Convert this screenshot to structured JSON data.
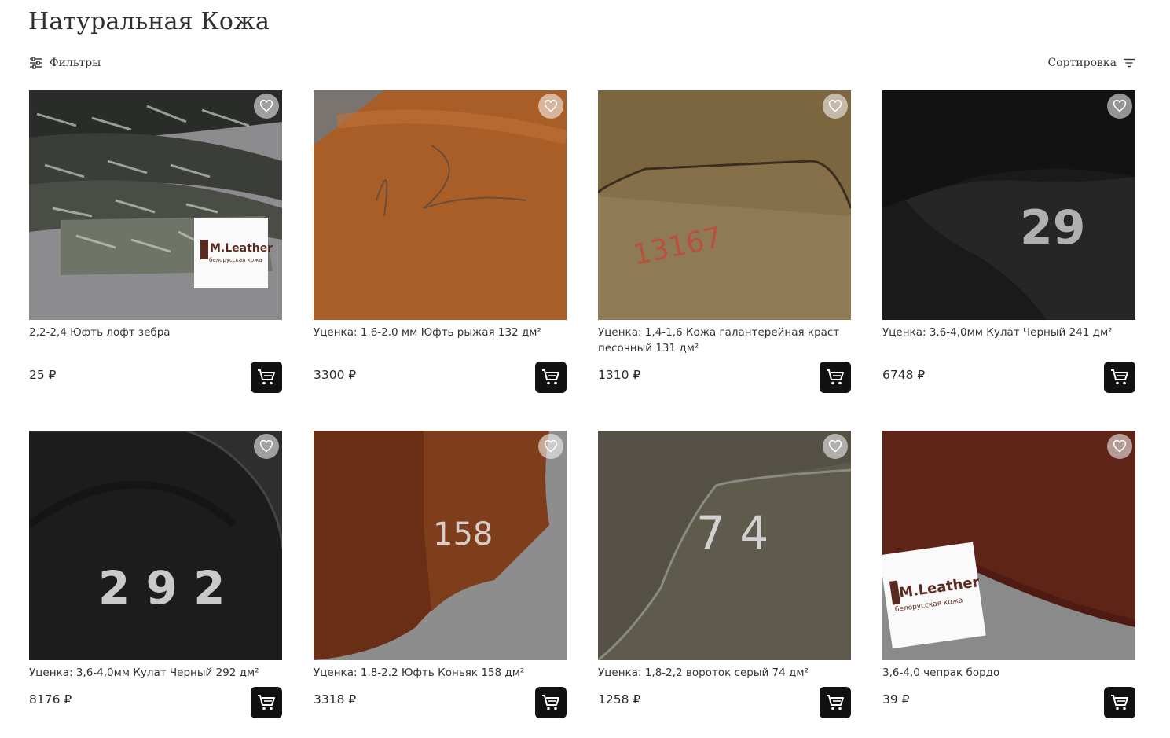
{
  "page": {
    "title": "Натуральная Кожа"
  },
  "toolbar": {
    "filters_label": "Фильтры",
    "sort_label": "Сортировка"
  },
  "products": [
    {
      "name": "2,2-2,4 Юфть лофт зебра",
      "price": "25 ₽",
      "image": "leather-zebra-black-grey",
      "brand_card_text": "M.Leather",
      "brand_card_sub": "белорусская кожа"
    },
    {
      "name": "Уценка: 1.6-2.0 мм Юфть рыжая 132 дм²",
      "price": "3300 ₽",
      "image": "leather-orange-suede"
    },
    {
      "name": "Уценка: 1,4-1,6 Кожа галантерейная краст песочный 131 дм²",
      "price": "1310 ₽",
      "image": "leather-sand-crust",
      "marking": "13167"
    },
    {
      "name": "Уценка: 3,6-4,0мм Кулат Черный 241 дм²",
      "price": "6748 ₽",
      "image": "leather-black-kulat",
      "marking": "29"
    },
    {
      "name": "Уценка: 3,6-4,0мм Кулат Черный 292 дм²",
      "price": "8176 ₽",
      "image": "leather-black-kulat-2",
      "marking": "2 9 2"
    },
    {
      "name": "Уценка: 1.8-2.2 Юфть Коньяк 158 дм²",
      "price": "3318 ₽",
      "image": "leather-cognac",
      "marking": "158"
    },
    {
      "name": "Уценка: 1,8-2,2 вороток серый 74 дм²",
      "price": "1258 ₽",
      "image": "leather-grey-vorotok",
      "marking": "7 4"
    },
    {
      "name": "3,6-4,0 чепрак бордо",
      "price": "39 ₽",
      "image": "leather-bordeaux",
      "brand_card_text": "M.Leather",
      "brand_card_sub": "белорусская кожа"
    }
  ],
  "icons": {
    "favorite": "heart-icon",
    "cart": "cart-icon",
    "filters": "sliders-icon",
    "sort": "sort-lines-icon"
  },
  "colors": {
    "cart_button": "#111111",
    "text": "#2b2b2b"
  }
}
